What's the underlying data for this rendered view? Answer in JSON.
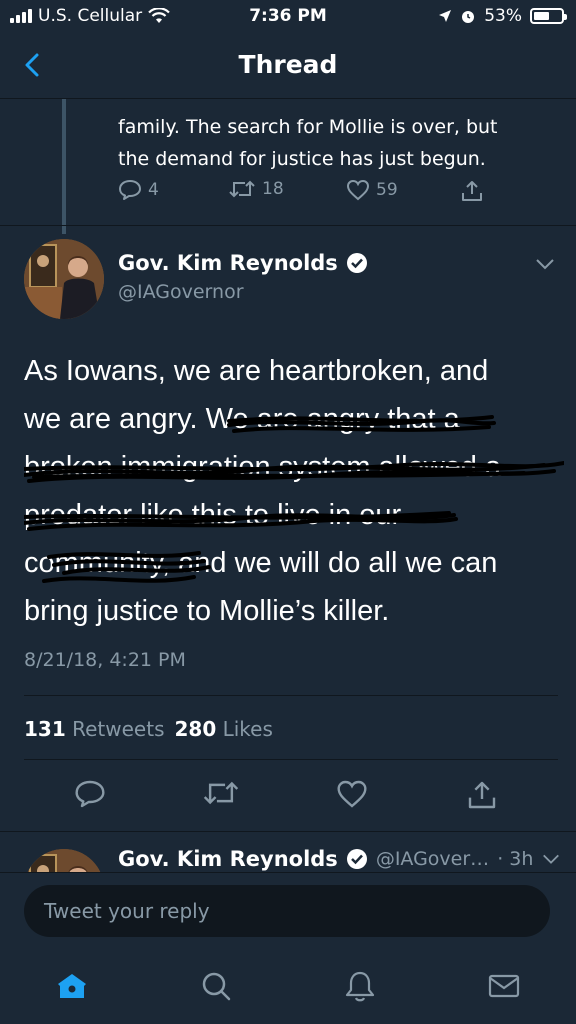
{
  "status_bar": {
    "carrier": "U.S. Cellular",
    "time": "7:36 PM",
    "battery": "53%"
  },
  "nav": {
    "title": "Thread"
  },
  "previous_tweet": {
    "text_lines": [
      "family. The search for Mollie is over, but",
      "the demand for justice has just begun."
    ],
    "replies": "4",
    "retweets": "18",
    "likes": "59"
  },
  "tweet": {
    "name": "Gov. Kim Reynolds",
    "handle": "@IAGovernor",
    "lines": [
      "As Iowans, we are heartbroken, and",
      "we are angry. We are angry that a",
      "broken immigration system allowed a",
      "predator like this to live in our",
      "community, and we will do all we can",
      "bring justice to Mollie’s killer."
    ],
    "timestamp": "8/21/18, 4:21 PM",
    "retweet_count": "131",
    "retweet_label": "Retweets",
    "like_count": "280",
    "like_label": "Likes"
  },
  "next_tweet": {
    "name": "Gov. Kim Reynolds",
    "handle": "@IAGover…",
    "time": "· 3h"
  },
  "reply": {
    "placeholder": "Tweet your reply"
  },
  "colors": {
    "background": "#1b2836",
    "accent": "#1da1f2",
    "muted": "#8899a6"
  },
  "icons": [
    "signal-icon",
    "wifi-icon",
    "location-icon",
    "alarm-icon",
    "battery-icon",
    "back-icon",
    "reply-icon",
    "retweet-icon",
    "like-icon",
    "share-icon",
    "verified-icon",
    "chevron-down-icon",
    "home-icon",
    "search-icon",
    "notifications-icon",
    "messages-icon"
  ]
}
